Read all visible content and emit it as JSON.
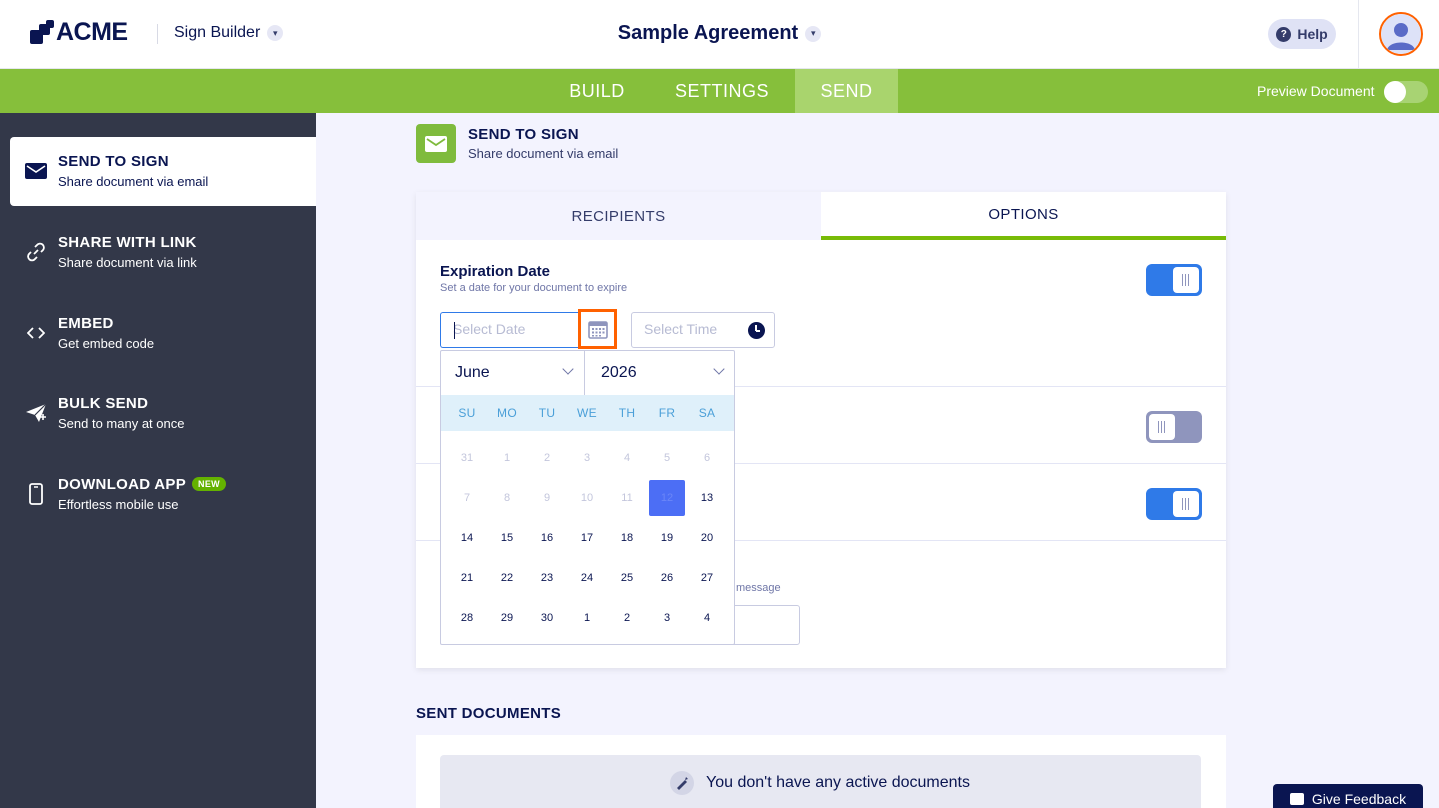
{
  "header": {
    "logo_text": "ACME",
    "app_name": "Sign Builder",
    "document_title": "Sample Agreement",
    "help_label": "Help"
  },
  "nav": {
    "tabs": [
      {
        "label": "BUILD",
        "active": false
      },
      {
        "label": "SETTINGS",
        "active": false
      },
      {
        "label": "SEND",
        "active": true
      }
    ],
    "preview_label": "Preview Document",
    "preview_on": false
  },
  "sidebar": {
    "items": [
      {
        "title": "SEND TO SIGN",
        "subtitle": "Share document via email",
        "icon": "envelope-icon",
        "active": true
      },
      {
        "title": "SHARE WITH LINK",
        "subtitle": "Share document via link",
        "icon": "link-icon",
        "active": false
      },
      {
        "title": "EMBED",
        "subtitle": "Get embed code",
        "icon": "code-icon",
        "active": false
      },
      {
        "title": "BULK SEND",
        "subtitle": "Send to many at once",
        "icon": "paper-plane-icon",
        "active": false
      },
      {
        "title": "DOWNLOAD APP",
        "subtitle": "Effortless mobile use",
        "icon": "phone-icon",
        "active": false,
        "badge": "NEW"
      }
    ]
  },
  "main": {
    "section_title": "SEND TO SIGN",
    "section_subtitle": "Share document via email",
    "tabs": {
      "recipients": "RECIPIENTS",
      "options": "OPTIONS"
    },
    "expiration": {
      "title": "Expiration Date",
      "subtitle": "Set a date for your document to expire",
      "date_placeholder": "Select Date",
      "time_placeholder": "Select Time",
      "enabled": true
    },
    "option_toggles": [
      true,
      false,
      true
    ],
    "message_hint": "message"
  },
  "calendar": {
    "month": "June",
    "year": "2026",
    "weekdays": [
      "SU",
      "MO",
      "TU",
      "WE",
      "TH",
      "FR",
      "SA"
    ],
    "weeks": [
      [
        "31",
        "1",
        "2",
        "3",
        "4",
        "5",
        "6"
      ],
      [
        "7",
        "8",
        "9",
        "10",
        "11",
        "12",
        "13"
      ],
      [
        "14",
        "15",
        "16",
        "17",
        "18",
        "19",
        "20"
      ],
      [
        "21",
        "22",
        "23",
        "24",
        "25",
        "26",
        "27"
      ],
      [
        "28",
        "29",
        "30",
        "1",
        "2",
        "3",
        "4"
      ]
    ],
    "disabled_through_index": 11,
    "selected_index": 12
  },
  "sent": {
    "title": "SENT DOCUMENTS",
    "empty_text": "You don't have any active documents"
  },
  "feedback_label": "Give Feedback",
  "colors": {
    "green": "#86bf3b",
    "navy": "#0a1551",
    "sidebar": "#333849",
    "accent_blue": "#2f7ae8",
    "highlight_orange": "#ff6100"
  }
}
